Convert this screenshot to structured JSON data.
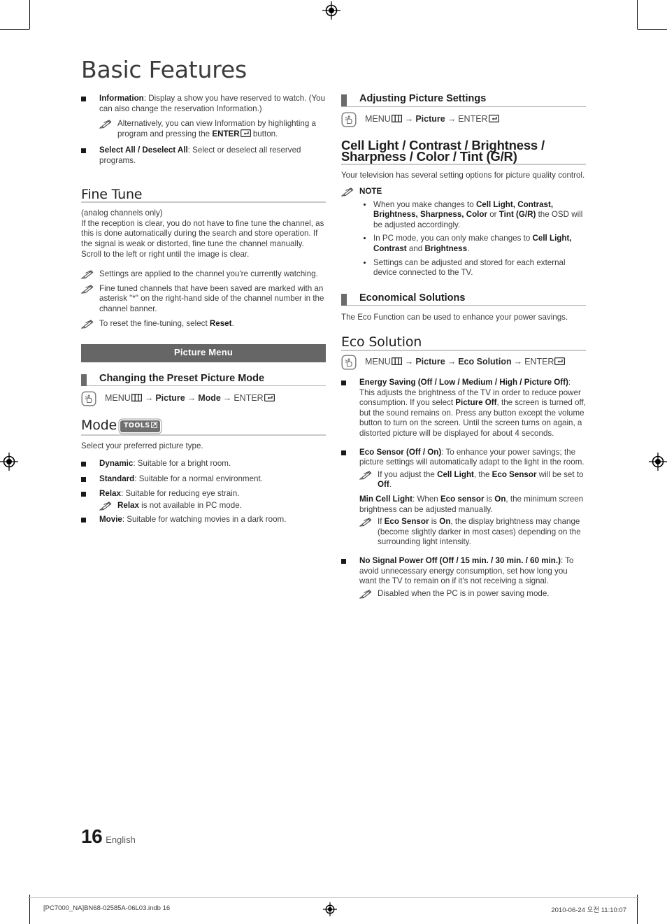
{
  "document": {
    "title": "Basic Features",
    "page_number": "16",
    "language": "English"
  },
  "footer": {
    "file": "[PC7000_NA]BN68-02585A-06L03.indb   16",
    "timestamp": "2010-06-24   오전 11:10:07"
  },
  "left_column": {
    "bullets_top": [
      {
        "term": "Information",
        "text": ": Display a show you have reserved to watch. (You can also change the reservation Information.)",
        "note": "Alternatively, you can view Information by highlighting a program and pressing the ENTER button."
      },
      {
        "term": "Select All / Deselect All",
        "text": ": Select or deselect all reserved programs."
      }
    ],
    "fine_tune": {
      "heading": "Fine Tune",
      "subtitle": "(analog channels only)",
      "body": "If the reception is clear, you do not have to fine tune the channel, as this is done automatically during the search and store operation. If the signal is weak or distorted, fine tune the channel manually. Scroll to the left or right until the image is clear.",
      "notes": [
        "Settings are applied to the channel you're currently watching.",
        "Fine tuned channels that have been saved are marked with an asterisk \"*\" on the right-hand side of the channel number in the channel banner.",
        "To reset the fine-tuning, select Reset."
      ]
    },
    "picture_menu_banner": "Picture Menu",
    "preset_mode": {
      "heading": "Changing the Preset Picture Mode",
      "path": {
        "menu": "MENU",
        "steps": [
          "Picture",
          "Mode"
        ],
        "enter": "ENTER"
      }
    },
    "mode": {
      "heading": "Mode",
      "tools_badge": "TOOLS",
      "intro": "Select your preferred picture type.",
      "items": [
        {
          "term": "Dynamic",
          "text": ": Suitable for a bright room."
        },
        {
          "term": "Standard",
          "text": ": Suitable for a normal environment."
        },
        {
          "term": "Relax",
          "text": ": Suitable for reducing eye strain.",
          "note_bold": "Relax",
          "note_text": " is not available in PC mode."
        },
        {
          "term": "Movie",
          "text": ": Suitable for watching movies in a dark room."
        }
      ]
    }
  },
  "right_column": {
    "adjusting": {
      "heading": "Adjusting Picture Settings",
      "path": {
        "menu": "MENU",
        "steps": [
          "Picture"
        ],
        "enter": "ENTER"
      }
    },
    "cell_light": {
      "heading_line1": "Cell Light / Contrast / Brightness /",
      "heading_line2": "Sharpness / Color / Tint (G/R)",
      "body": "Your television has several setting options for picture quality control.",
      "note_label": "NOTE",
      "note_items": [
        "When you make changes to Cell Light, Contrast, Brightness, Sharpness, Color or Tint (G/R) the OSD will be adjusted accordingly.",
        "In PC mode, you can only make changes to Cell Light, Contrast and Brightness.",
        "Settings can be adjusted and stored for each external device connected to the TV."
      ]
    },
    "economical": {
      "heading": "Economical Solutions",
      "body": "The Eco Function can be used to enhance your power savings."
    },
    "eco_solution": {
      "heading": "Eco Solution",
      "path": {
        "menu": "MENU",
        "steps": [
          "Picture",
          "Eco Solution"
        ],
        "enter": "ENTER"
      },
      "items": [
        {
          "term": "Energy Saving (Off / Low / Medium / High / Picture Off)",
          "text": ": This adjusts the brightness of the TV in order to reduce power consumption. If you select Picture Off, the screen is turned off, but the sound remains on. Press any button except the volume button to turn on the screen. Until the screen turns on again, a distorted picture will be displayed for about 4 seconds."
        },
        {
          "term": "Eco Sensor (Off / On)",
          "text": ": To enhance your power savings; the picture settings will automatically adapt to the light in the room.",
          "note1": "If you adjust the Cell Light, the Eco Sensor will be set to Off.",
          "sub_term": "Min Cell Light",
          "sub_text": ": When Eco sensor is On, the minimum screen brightness can be adjusted manually.",
          "note2": "If Eco Sensor is On, the display brightness may change (become slightly darker in most cases) depending on the surrounding light intensity."
        },
        {
          "term": "No Signal Power Off (Off / 15 min. / 30 min. / 60 min.)",
          "text": ": To avoid unnecessary energy consumption, set how long you want the TV to remain on if it's not receiving a signal.",
          "note1": "Disabled when the PC is in power saving mode."
        }
      ]
    }
  },
  "colors": {
    "banner_bg": "#666666",
    "tab_grey": "#6b6b6b",
    "rule_grey": "#c9c9c9",
    "text": "#3c3c3c"
  }
}
